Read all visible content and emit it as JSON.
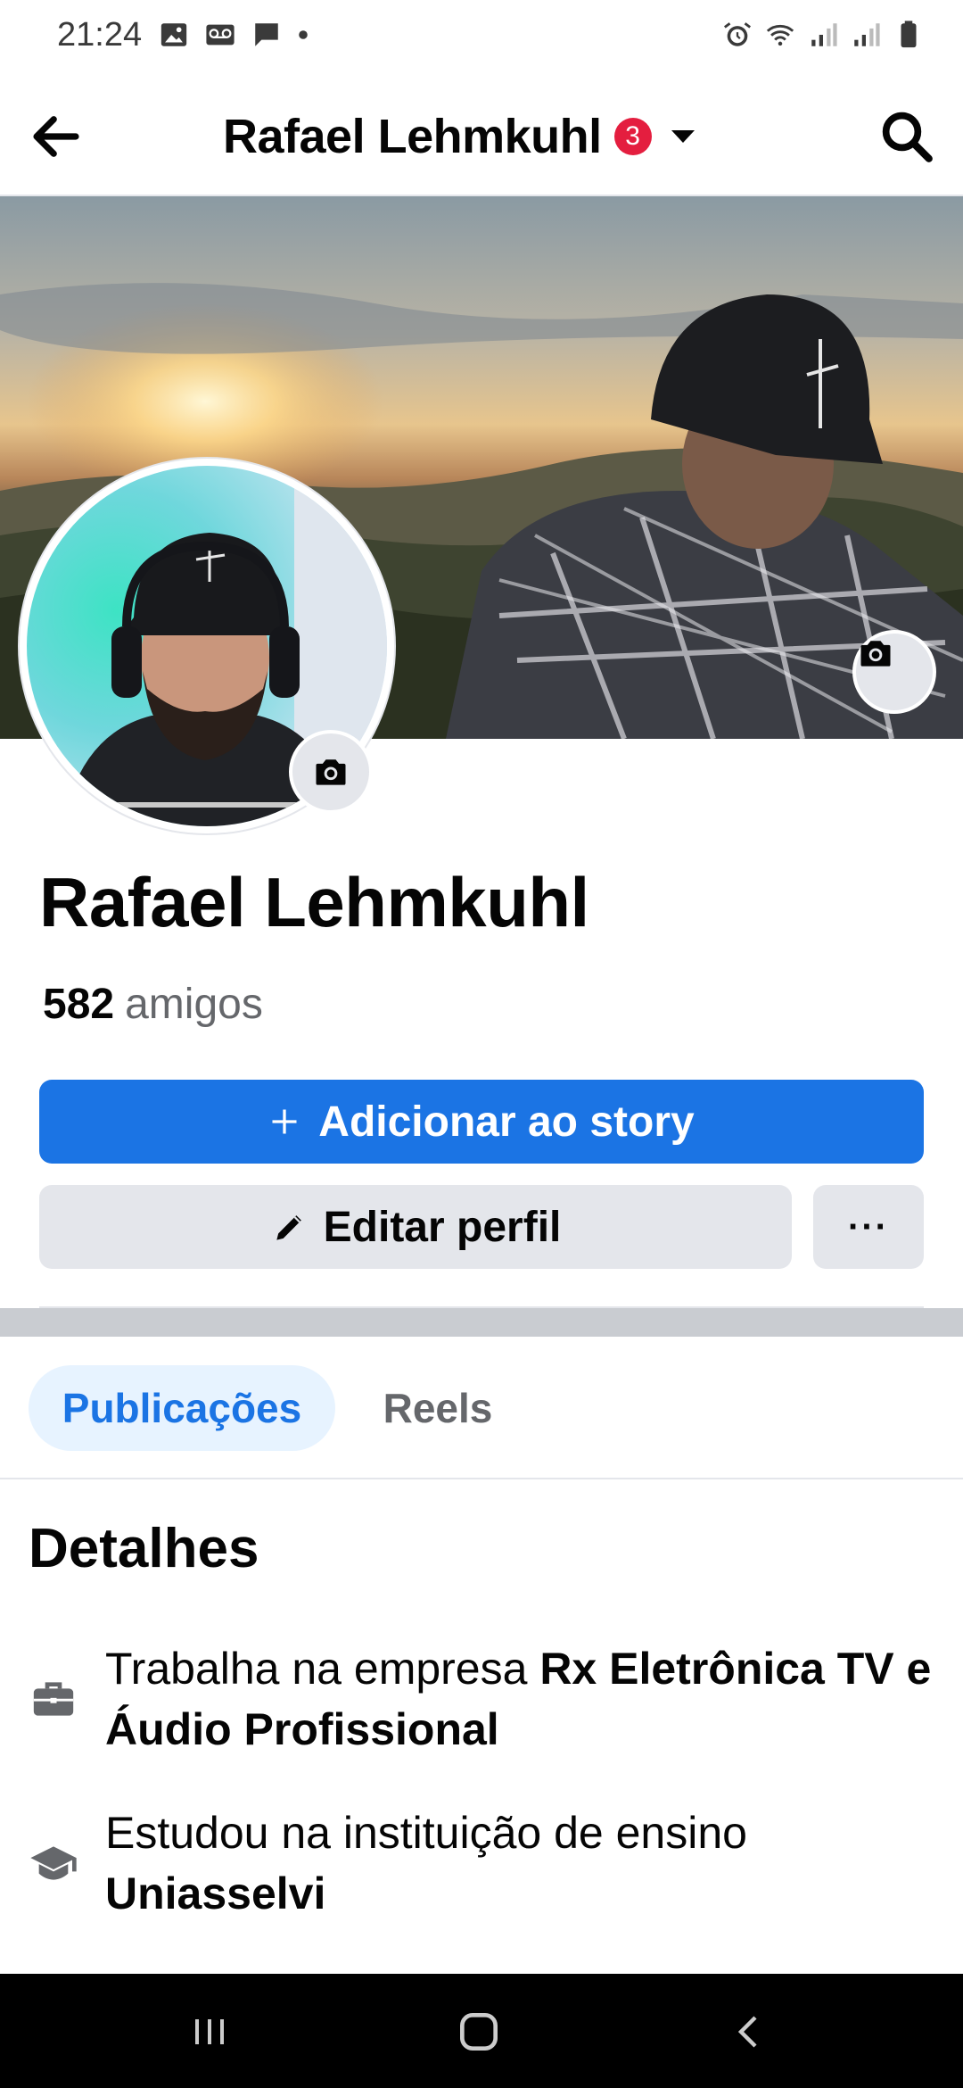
{
  "status_bar": {
    "time": "21:24",
    "left_icons": [
      "image-icon",
      "voicemail-icon",
      "message-icon",
      "dot-icon"
    ],
    "right_icons": [
      "alarm-icon",
      "wifi-icon",
      "signal-icon",
      "signal-icon",
      "battery-icon"
    ]
  },
  "nav": {
    "title": "Rafael Lehmkuhl",
    "badge_count": "3"
  },
  "profile": {
    "name": "Rafael Lehmkuhl",
    "friends_count": "582",
    "friends_label": "amigos"
  },
  "actions": {
    "add_story": "Adicionar ao story",
    "edit_profile": "Editar perfil",
    "more": "···"
  },
  "tabs": [
    {
      "label": "Publicações",
      "active": true
    },
    {
      "label": "Reels",
      "active": false
    }
  ],
  "details": {
    "title": "Detalhes",
    "work_prefix": "Trabalha na empresa ",
    "work_place": "Rx Eletrônica TV e Áudio Profissional",
    "study_prefix": "Estudou na instituição de ensino ",
    "study_place": "Uniasselvi"
  },
  "colors": {
    "accent": "#1b74e4",
    "badge": "#e41e3f",
    "button_gray": "#e4e6eb",
    "tab_active_bg": "#e7f3ff"
  }
}
